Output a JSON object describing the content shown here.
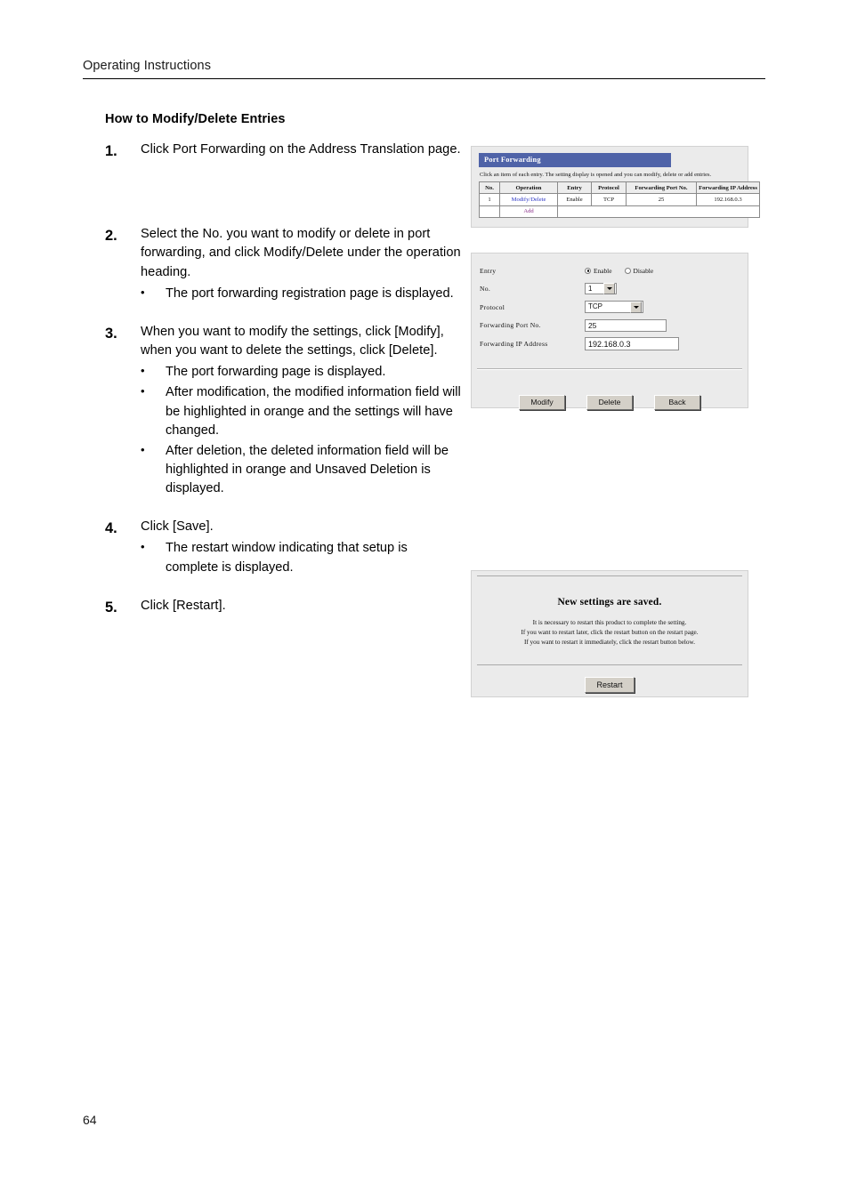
{
  "header": {
    "running_head": "Operating Instructions"
  },
  "section": {
    "title": "How to Modify/Delete Entries"
  },
  "steps": [
    {
      "num": "1.",
      "text": "Click Port Forwarding on the Address Translation page.",
      "bullets": []
    },
    {
      "num": "2.",
      "text": "Select the No. you want to modify or delete in port forwarding, and click Modify/Delete under the operation heading.",
      "bullets": [
        "The port forwarding registration page is displayed."
      ]
    },
    {
      "num": "3.",
      "text": "When you want to modify the settings, click [Modify], when you want to delete the settings, click [Delete].",
      "bullets": [
        "The port forwarding page is displayed.",
        "After modification, the modified information field will be highlighted in orange and the settings will have changed.",
        "After deletion, the deleted information field will be highlighted in orange and Unsaved Deletion is displayed."
      ]
    },
    {
      "num": "4.",
      "text": "Click [Save].",
      "bullets": [
        "The restart window indicating that setup is complete is displayed."
      ]
    },
    {
      "num": "5.",
      "text": "Click [Restart].",
      "bullets": []
    }
  ],
  "bullet_glyph": "•",
  "figure_port_forwarding_list": {
    "titlebar": "Port Forwarding",
    "description": "Click an item of each entry. The setting display is opened and you can modify, delete or add entries.",
    "columns": [
      "No.",
      "Operation",
      "Entry",
      "Protocol",
      "Forwarding Port No.",
      "Forwarding IP Address"
    ],
    "rows": [
      {
        "no": "1",
        "operation": "Modify/Delete",
        "entry": "Enable",
        "protocol": "TCP",
        "port": "25",
        "ip": "192.168.0.3"
      }
    ],
    "add_link": "Add",
    "colors": {
      "titlebar_bg": "#4f63a8",
      "modify_link": "#2b35c4",
      "add_link": "#8a2f8a"
    }
  },
  "figure_entry_form": {
    "labels": {
      "entry": "Entry",
      "no": "No.",
      "protocol": "Protocol",
      "port": "Forwarding Port No.",
      "ip": "Forwarding IP Address"
    },
    "entry_radio": {
      "enable_label": "Enable",
      "disable_label": "Disable",
      "selected": "Enable"
    },
    "no_value": "1",
    "protocol_value": "TCP",
    "port_value": "25",
    "ip_value": "192.168.0.3",
    "buttons": {
      "modify": "Modify",
      "delete": "Delete",
      "back": "Back"
    }
  },
  "figure_saved": {
    "title": "New settings are saved.",
    "line1": "It is necessary to restart this product to complete the setting.",
    "line2": "If you want to restart later, click the restart button on the restart page.",
    "line3": "If you want to restart it immediately, click the restart button below.",
    "restart_button": "Restart"
  },
  "folio": {
    "page_number": "64"
  }
}
